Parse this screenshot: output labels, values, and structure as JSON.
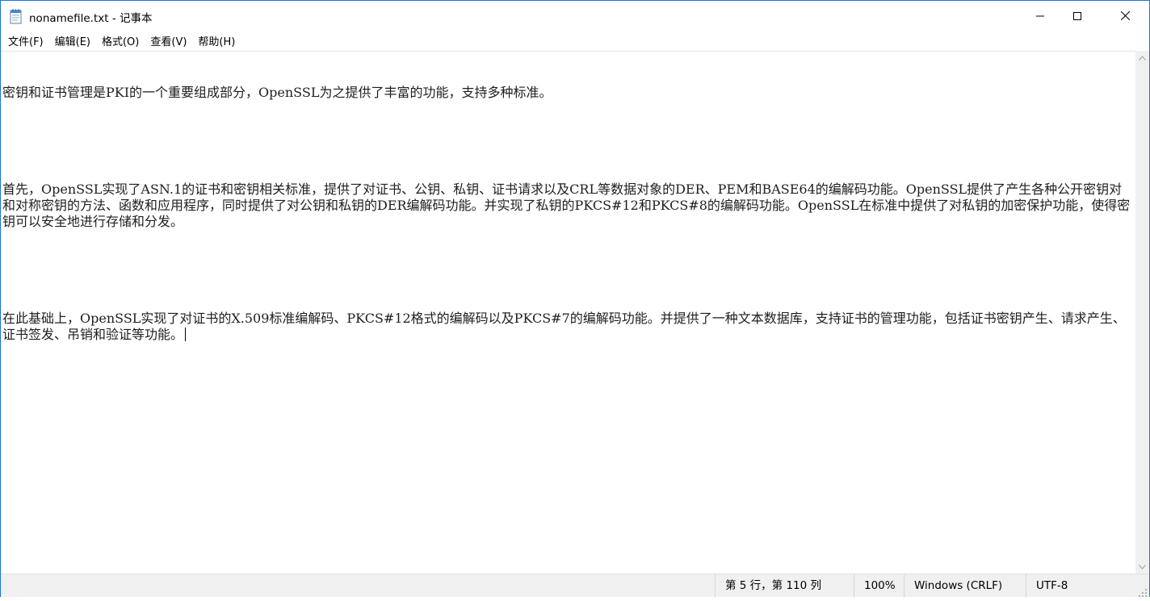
{
  "window": {
    "title": "nonamefile.txt - 记事本"
  },
  "menu": {
    "items": [
      {
        "label": "文件(F)"
      },
      {
        "label": "编辑(E)"
      },
      {
        "label": "格式(O)"
      },
      {
        "label": "查看(V)"
      },
      {
        "label": "帮助(H)"
      }
    ]
  },
  "editor": {
    "paragraphs": [
      "密钥和证书管理是PKI的一个重要组成部分，OpenSSL为之提供了丰富的功能，支持多种标准。",
      "",
      "首先，OpenSSL实现了ASN.1的证书和密钥相关标准，提供了对证书、公钥、私钥、证书请求以及CRL等数据对象的DER、PEM和BASE64的编解码功能。OpenSSL提供了产生各种公开密钥对和对称密钥的方法、函数和应用程序，同时提供了对公钥和私钥的DER编解码功能。并实现了私钥的PKCS#12和PKCS#8的编解码功能。OpenSSL在标准中提供了对私钥的加密保护功能，使得密钥可以安全地进行存储和分发。",
      "",
      "在此基础上，OpenSSL实现了对证书的X.509标准编解码、PKCS#12格式的编解码以及PKCS#7的编解码功能。并提供了一种文本数据库，支持证书的管理功能，包括证书密钥产生、请求产生、证书签发、吊销和验证等功能。"
    ]
  },
  "statusbar": {
    "position": "第 5 行，第 110 列",
    "zoom": "100%",
    "line_ending": "Windows (CRLF)",
    "encoding": "UTF-8"
  },
  "icons": {
    "app": "notepad-icon",
    "minimize": "minimize-icon",
    "maximize": "maximize-icon",
    "close": "close-icon",
    "scroll_up": "scroll-up-arrow-icon",
    "scroll_down": "scroll-down-arrow-icon",
    "grip": "resize-grip-icon"
  },
  "colors": {
    "frame_border": "#1a73d9",
    "statusbar_bg": "#f0f0f0"
  }
}
